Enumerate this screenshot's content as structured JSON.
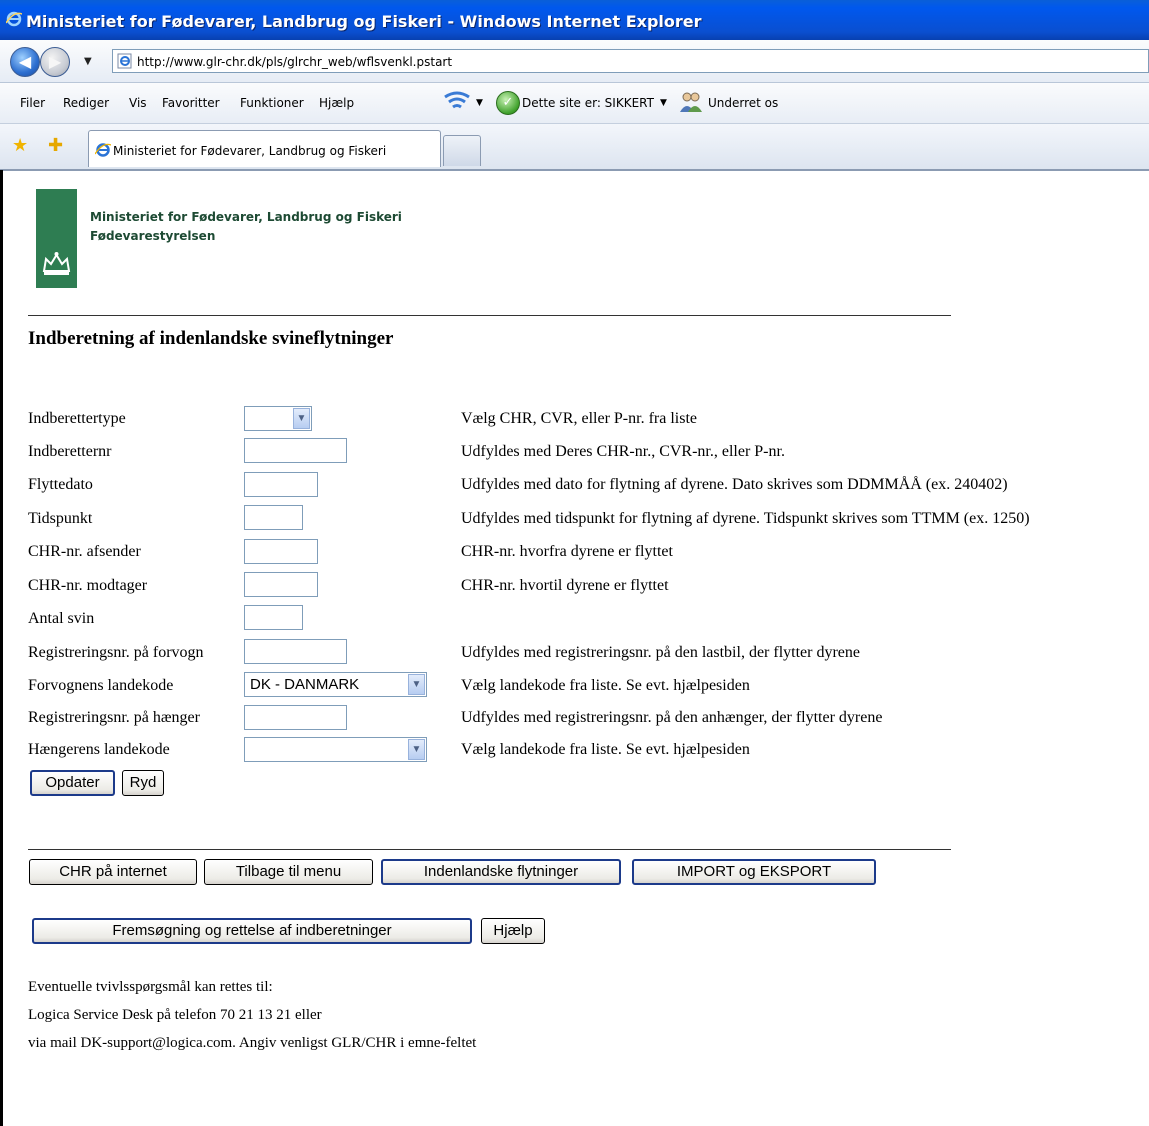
{
  "window": {
    "title": "Ministeriet for Fødevarer, Landbrug og Fiskeri - Windows Internet Explorer"
  },
  "browser": {
    "url": "http://www.glr-chr.dk/pls/glrchr_web/wflsvenkl.pstart",
    "back_glyph": "◀",
    "fwd_glyph": "▶",
    "dropdown_glyph": "▼",
    "menu": [
      "Filer",
      "Rediger",
      "Vis",
      "Favoritter",
      "Funktioner",
      "Hjælp"
    ],
    "site_status": "Dette site er: SIKKERT",
    "notify": "Underret os",
    "tab_title": "Ministeriet for Fødevarer, Landbrug og Fiskeri"
  },
  "header": {
    "org_name": "Ministeriet for Fødevarer, Landbrug og Fiskeri",
    "agency": "Fødevarestyrelsen",
    "logo_color": "#2e7d52"
  },
  "page": {
    "title": "Indberetning af indenlandske svineflytninger"
  },
  "form": {
    "rows": [
      {
        "label": "Indberettertype",
        "hint": "Vælg CHR, CVR, eller P-nr. fra liste",
        "value": ""
      },
      {
        "label": "Indberetternr",
        "hint": "Udfyldes med Deres CHR-nr., CVR-nr., eller P-nr.",
        "value": ""
      },
      {
        "label": "Flyttedato",
        "hint": "Udfyldes med dato for flytning af dyrene. Dato skrives som DDMMÅÅ (ex. 240402)",
        "value": ""
      },
      {
        "label": "Tidspunkt",
        "hint": "Udfyldes med tidspunkt for flytning af dyrene. Tidspunkt skrives som TTMM (ex. 1250)",
        "value": ""
      },
      {
        "label": "CHR-nr. afsender",
        "hint": "CHR-nr. hvorfra dyrene er flyttet",
        "value": ""
      },
      {
        "label": "CHR-nr. modtager",
        "hint": "CHR-nr. hvortil dyrene er flyttet",
        "value": ""
      },
      {
        "label": "Antal svin",
        "hint": "",
        "value": ""
      },
      {
        "label": "Registreringsnr. på forvogn",
        "hint": "Udfyldes med registreringsnr. på den lastbil, der flytter dyrene",
        "value": ""
      },
      {
        "label": "Forvognens landekode",
        "hint": "Vælg landekode fra liste. Se evt. hjælpesiden",
        "value": "DK - DANMARK"
      },
      {
        "label": "Registreringsnr. på hænger",
        "hint": "Udfyldes med registreringsnr. på den anhænger, der flytter dyrene",
        "value": ""
      },
      {
        "label": "Hængerens landekode",
        "hint": "Vælg landekode fra liste. Se evt. hjælpesiden",
        "value": ""
      }
    ],
    "update_label": "Opdater",
    "clear_label": "Ryd"
  },
  "nav": {
    "chr_internet": "CHR på internet",
    "back_menu": "Tilbage til menu",
    "domestic": "Indenlandske flytninger",
    "import_export": "IMPORT og EKSPORT",
    "search_fix": "Fremsøgning og rettelse af indberetninger",
    "help": "Hjælp"
  },
  "contact": {
    "line1": "Eventuelle tvivlsspørgsmål kan rettes til:",
    "line2": "Logica Service Desk på telefon 70 21 13 21 eller",
    "line3": "via mail DK-support@logica.com. Angiv venligst GLR/CHR i emne-feltet"
  }
}
